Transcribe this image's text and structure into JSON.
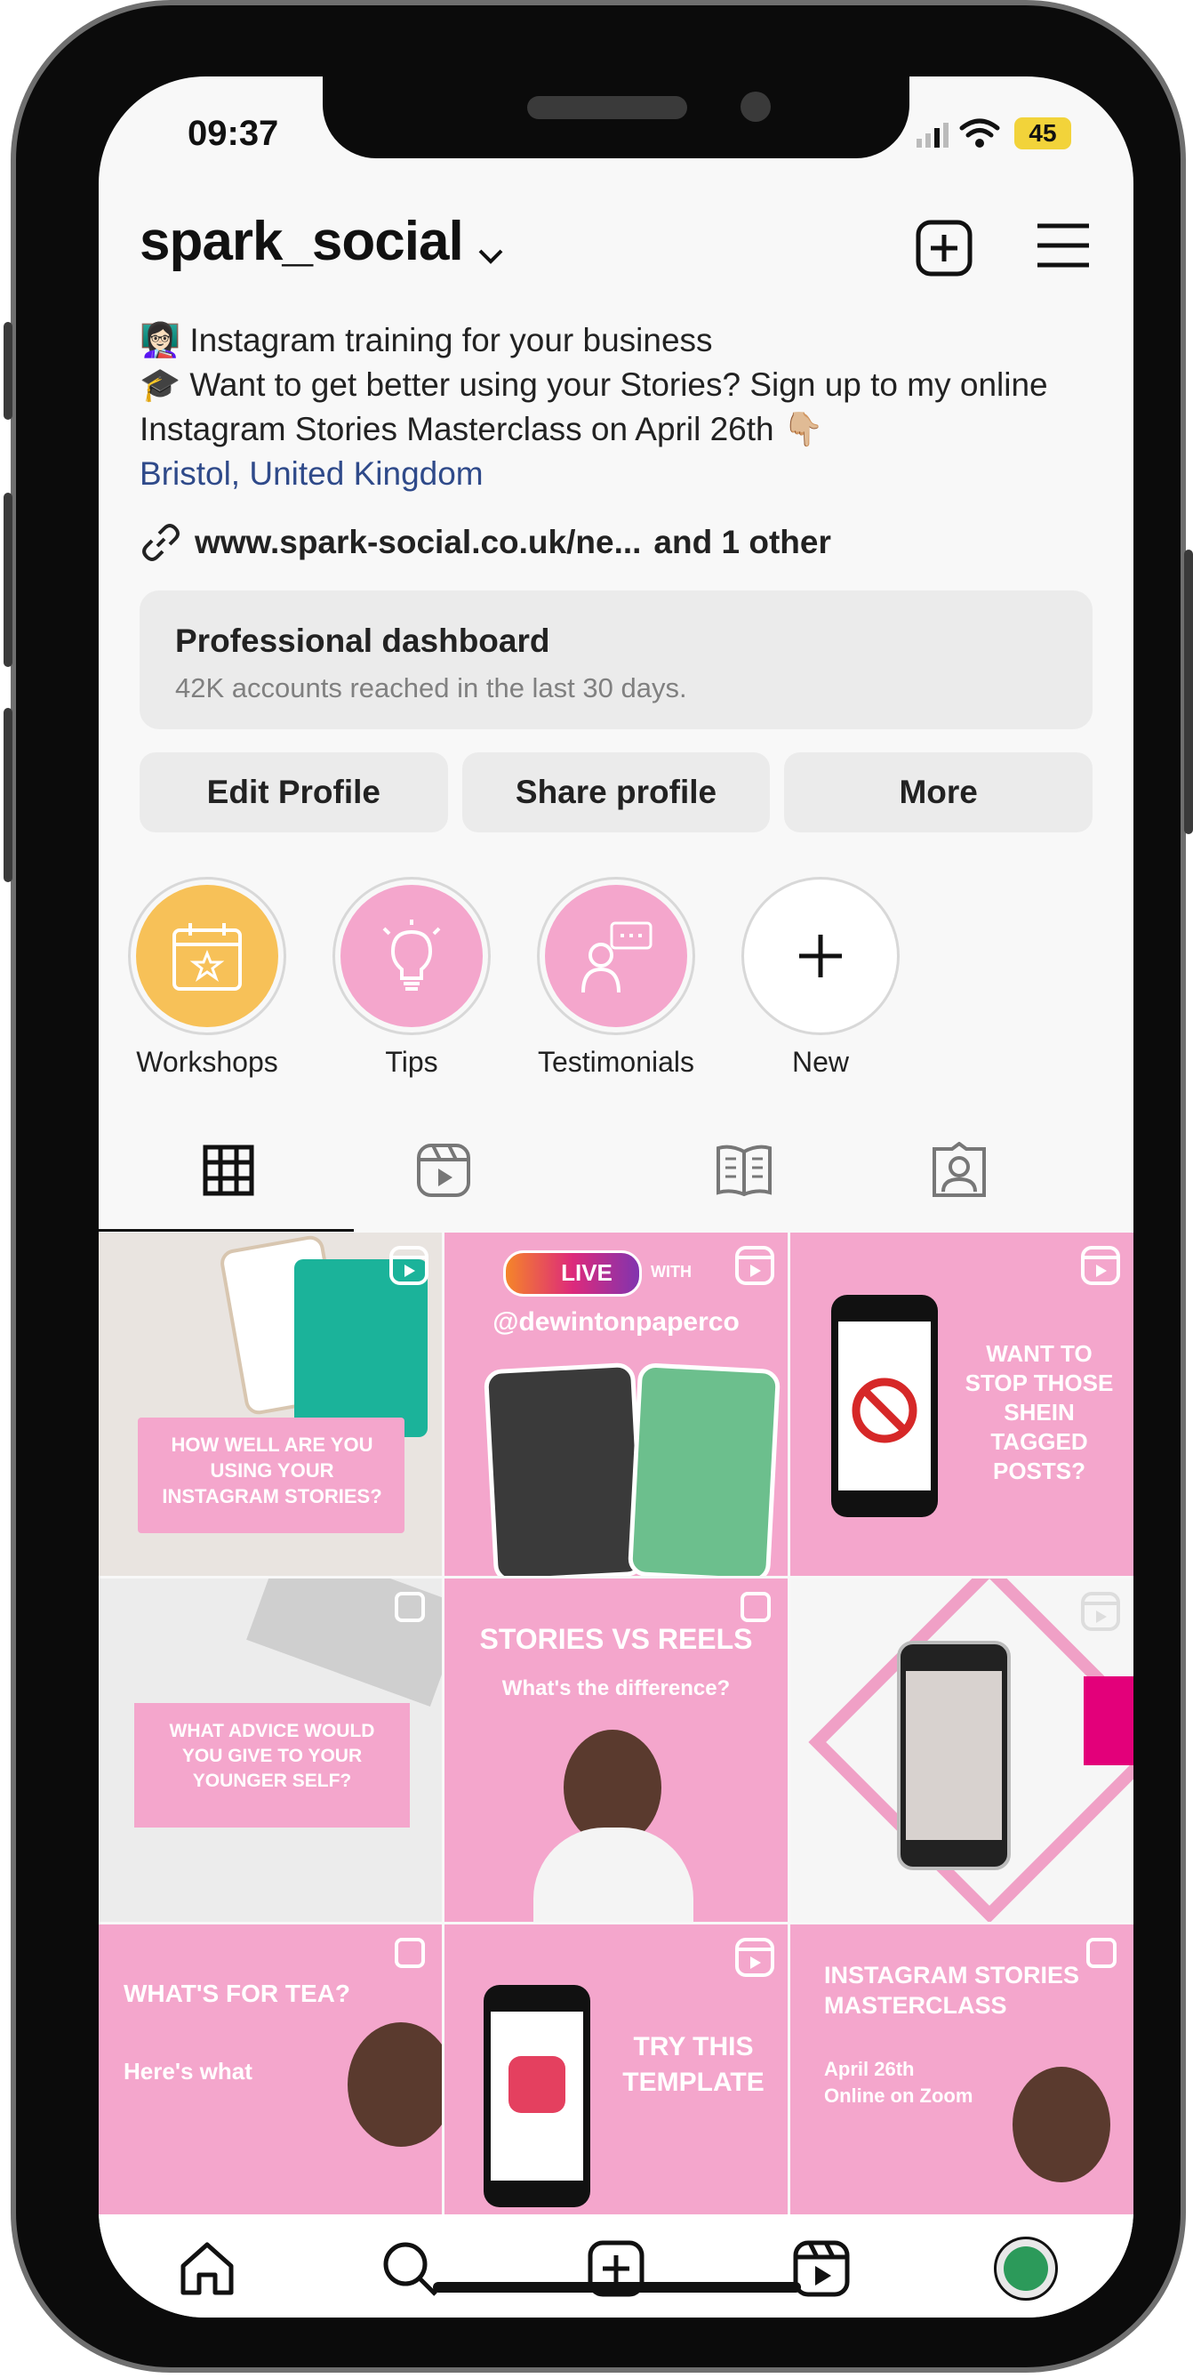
{
  "status": {
    "time": "09:37",
    "battery": "45"
  },
  "profile": {
    "username": "spark_social",
    "bio_line1": "Instagram training for your business",
    "bio_line2": "Want to get better using your Stories? Sign up to my online Instagram Stories Masterclass on April 26th",
    "location": "Bristol, United Kingdom",
    "link": "www.spark-social.co.uk/ne...",
    "link_other": "and 1 other"
  },
  "dashboard": {
    "title": "Professional dashboard",
    "subtitle": "42K accounts reached in the last 30 days."
  },
  "buttons": {
    "edit": "Edit Profile",
    "share": "Share profile",
    "more": "More"
  },
  "highlights": [
    {
      "label": "Workshops",
      "color": "#f7c158"
    },
    {
      "label": "Tips",
      "color": "#f4a6cc"
    },
    {
      "label": "Testimonials",
      "color": "#f4a6cc"
    },
    {
      "label": "New",
      "color": "#ffffff"
    }
  ],
  "posts": {
    "p1": "HOW WELL ARE YOU USING YOUR INSTAGRAM STORIES?",
    "p2_live": "LIVE",
    "p2_with": "WITH",
    "p2_handle": "@dewintonpaperco",
    "p3": "WANT TO STOP THOSE SHEIN TAGGED POSTS?",
    "p4": "WHAT ADVICE WOULD YOU GIVE TO YOUR YOUNGER SELF?",
    "p5_title": "STORIES VS REELS",
    "p5_sub": "What's the difference?",
    "p7_title": "WHAT'S FOR TEA?",
    "p7_sub": "Here's what",
    "p8": "TRY THIS TEMPLATE",
    "p9_title": "INSTAGRAM STORIES MASTERCLASS",
    "p9_sub1": "April 26th",
    "p9_sub2": "Online on Zoom"
  },
  "colors": {
    "pink": "#f4a6cc",
    "link_blue": "#2f4a8a",
    "yellow": "#f7c158"
  }
}
